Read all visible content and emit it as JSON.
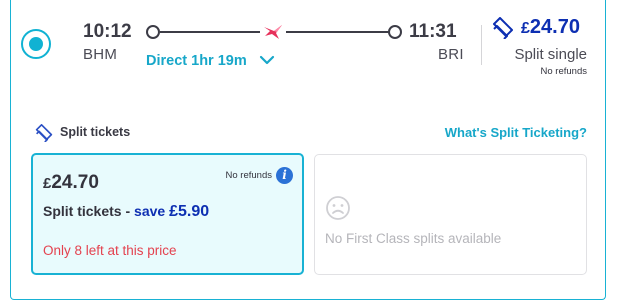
{
  "journey": {
    "departure_time": "10:12",
    "departure_station": "BHM",
    "arrival_time": "11:31",
    "arrival_station": "BRI",
    "summary": "Direct 1hr 19m"
  },
  "price_summary": {
    "currency": "£",
    "amount": "24.70",
    "fare_type": "Split single",
    "refund_note": "No refunds"
  },
  "split_section": {
    "title": "Split tickets",
    "help_link": "What's Split Ticketing?"
  },
  "split_option": {
    "currency": "£",
    "amount": "24.70",
    "refund_note": "No refunds",
    "label": "Split tickets - ",
    "save_label": "save ",
    "save_amount": "£5.90",
    "availability": "Only 8 left at this price"
  },
  "first_class_option": {
    "message": "No First Class splits available"
  },
  "icons": {
    "radio": "radio-selected-icon",
    "operator": "operator-logo-icon",
    "expand": "chevron-down-icon",
    "split_tag": "split-ticket-icon",
    "info": "info-icon",
    "unavailable": "sad-face-icon"
  },
  "colors": {
    "accent": "#18b2d4",
    "price": "#0d2fb2",
    "warning": "#e4424f",
    "info": "#2b72d6",
    "selected_bg": "#e8fbfd"
  }
}
